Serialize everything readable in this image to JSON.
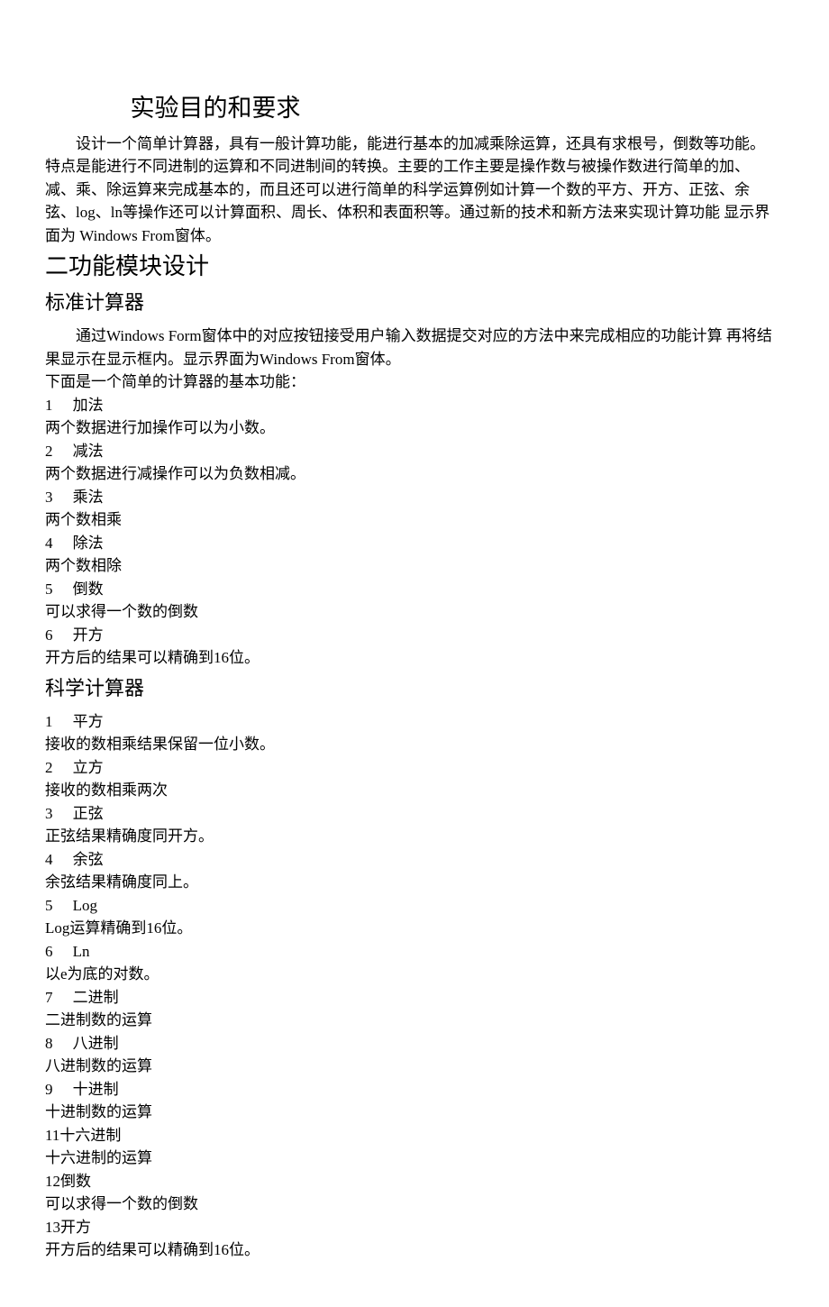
{
  "title": "实验目的和要求",
  "intro": "设计一个简单计算器，具有一般计算功能，能进行基本的加减乘除运算，还具有求根号，倒数等功能。 特点是能进行不同进制的运算和不同进制间的转换。主要的工作主要是操作数与被操作数进行简单的加、 减、乘、除运算来完成基本的，而且还可以进行简单的科学运算例如计算一个数的平方、开方、正弦、余 弦、log、ln等操作还可以计算面积、周长、体积和表面积等。通过新的技术和新方法来实现计算功能 显示界面为 Windows From窗体。",
  "section2_title": "二功能模块设计",
  "section2_sub1": "标准计算器",
  "section2_sub1_intro": "通过Windows Form窗体中的对应按钮接受用户输入数据提交对应的方法中来完成相应的功能计算 再将结果显示在显示框内。显示界面为Windows From窗体。",
  "section2_sub1_line1": "下面是一个简单的计算器的基本功能：",
  "std_items": [
    {
      "num": "1",
      "label": "加法",
      "desc": "两个数据进行加操作可以为小数。"
    },
    {
      "num": "2",
      "label": "减法",
      "desc": "两个数据进行减操作可以为负数相减。"
    },
    {
      "num": "3",
      "label": "乘法",
      "desc": "两个数相乘"
    },
    {
      "num": "4",
      "label": "除法",
      "desc": "两个数相除"
    },
    {
      "num": "5",
      "label": "倒数",
      "desc": "可以求得一个数的倒数"
    },
    {
      "num": "6",
      "label": "开方",
      "desc": "开方后的结果可以精确到16位。"
    }
  ],
  "section2_sub2": "科学计算器",
  "sci_items": [
    {
      "num": "1",
      "label": "平方",
      "desc": "接收的数相乘结果保留一位小数。"
    },
    {
      "num": "2",
      "label": "立方",
      "desc": "接收的数相乘两次"
    },
    {
      "num": "3",
      "label": "正弦",
      "desc": "正弦结果精确度同开方。"
    },
    {
      "num": "4",
      "label": "余弦",
      "desc": "余弦结果精确度同上。"
    },
    {
      "num": "5",
      "label": "Log",
      "desc": "Log运算精确到16位。"
    },
    {
      "num": "6",
      "label": "Ln",
      "desc": "以e为底的对数。"
    },
    {
      "num": "7",
      "label": "二进制",
      "desc": "二进制数的运算"
    },
    {
      "num": "8",
      "label": "八进制",
      "desc": "八进制数的运算"
    },
    {
      "num": "9",
      "label": "十进制",
      "desc": "十进制数的运算"
    },
    {
      "num": "11",
      "label": "十六进制",
      "desc": "十六进制的运算",
      "nogap": true
    },
    {
      "num": "12",
      "label": "倒数",
      "desc": "可以求得一个数的倒数",
      "nogap": true
    },
    {
      "num": "13",
      "label": "开方",
      "desc": "开方后的结果可以精确到16位。",
      "nogap": true
    }
  ]
}
